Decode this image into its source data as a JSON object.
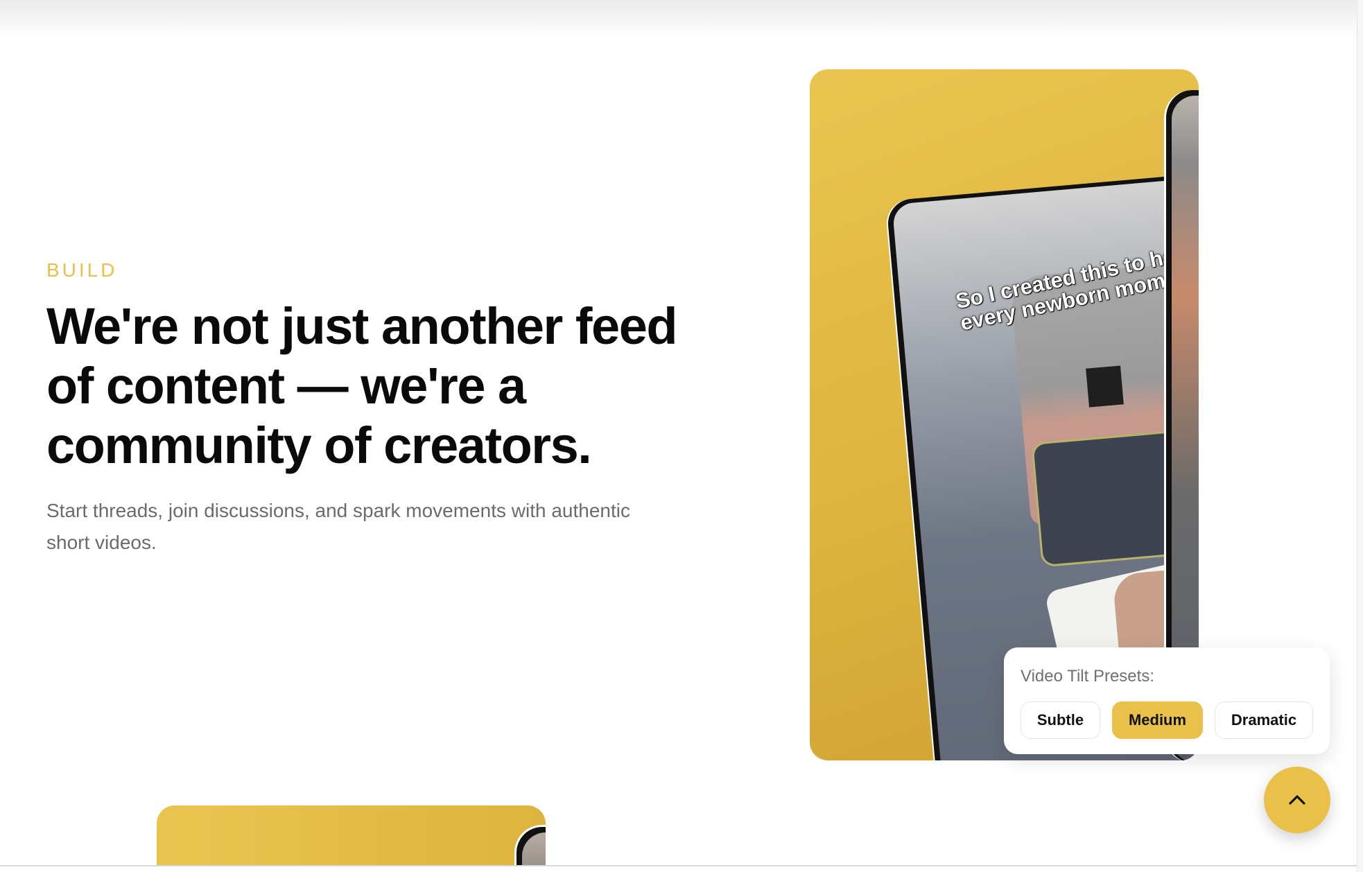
{
  "section": {
    "eyebrow": "BUILD",
    "headline": "We're not just another feed of content — we're a community of creators.",
    "subtext": "Start threads, join discussions, and spark movements with authentic short videos."
  },
  "video": {
    "caption_line1": "So I created this to help",
    "caption_line2": "every newborn mom 🥺"
  },
  "presets": {
    "label": "Video Tilt Presets:",
    "options": [
      "Subtle",
      "Medium",
      "Dramatic"
    ],
    "selected": "Medium"
  },
  "colors": {
    "accent": "#e9c04a",
    "headline": "#0a0a0a",
    "subtext": "#6b6b6b"
  },
  "icons": {
    "scroll_top": "chevron-up-icon"
  }
}
